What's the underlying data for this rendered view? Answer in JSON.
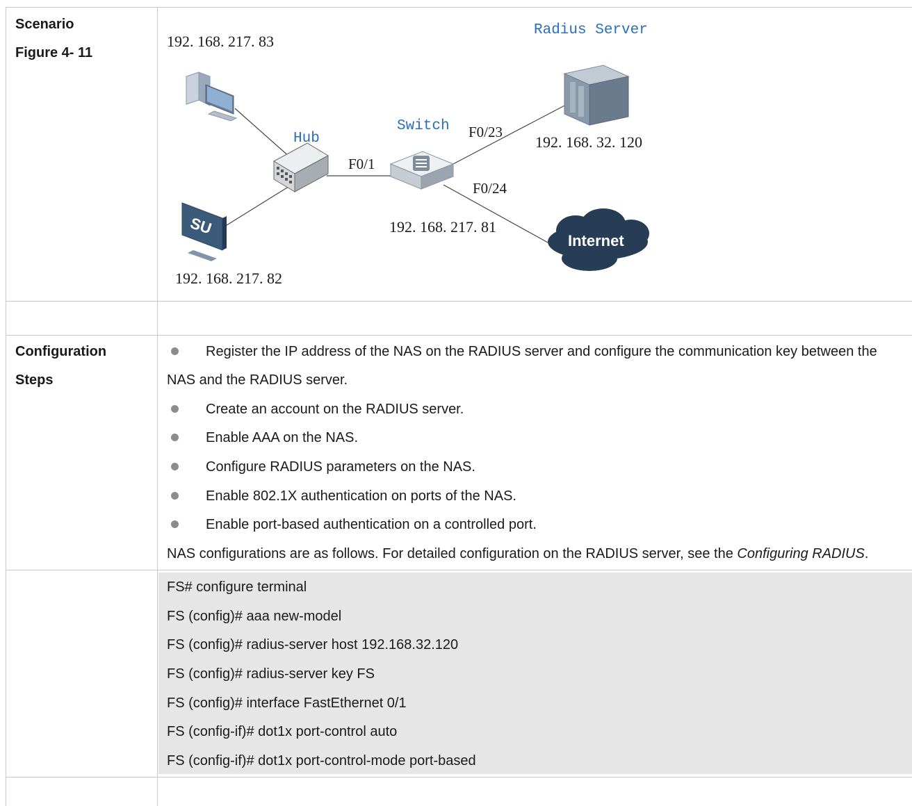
{
  "scenario": {
    "label_line1": "Scenario",
    "label_line2": "Figure 4- 11",
    "diagram": {
      "pc_ip": "192. 168. 217. 83",
      "hub_label": "Hub",
      "switch_label": "Switch",
      "radius_label": "Radius Server",
      "radius_ip": "192. 168. 32. 120",
      "port_f01": "F0/1",
      "port_f023": "F0/23",
      "port_f024": "F0/24",
      "switch_ip": "192. 168. 217. 81",
      "internet_label": "Internet",
      "monitor_logo": "SU",
      "monitor_ip": "192. 168. 217. 82"
    }
  },
  "config_steps": {
    "label_line1": "Configuration",
    "label_line2": "Steps",
    "bullets": [
      "Register the IP address of the NAS on the RADIUS server and configure the communication key between the",
      "Create an account on the RADIUS server.",
      "Enable AAA on the NAS.",
      "Configure RADIUS parameters on the NAS.",
      "Enable 802.1X authentication on ports of the NAS.",
      "Enable port-based authentication on a controlled port."
    ],
    "bullet1_continuation": "NAS and the RADIUS server.",
    "summary_prefix": "NAS configurations are as follows. For detailed configuration on the RADIUS server, see the ",
    "summary_italic": "Configuring RADIUS",
    "summary_suffix": "."
  },
  "commands": [
    "FS# configure terminal",
    "FS (config)# aaa new-model",
    "FS (config)# radius-server host 192.168.32.120",
    "FS (config)# radius-server key FS",
    "FS (config)# interface FastEthernet 0/1",
    "FS (config-if)# dot1x port-control auto",
    "FS (config-if)# dot1x port-control-mode port-based"
  ],
  "colors": {
    "diagram_label_blue": "#2a6fb5",
    "code_background": "#e6e6e6",
    "table_border": "#c8c8c8"
  }
}
